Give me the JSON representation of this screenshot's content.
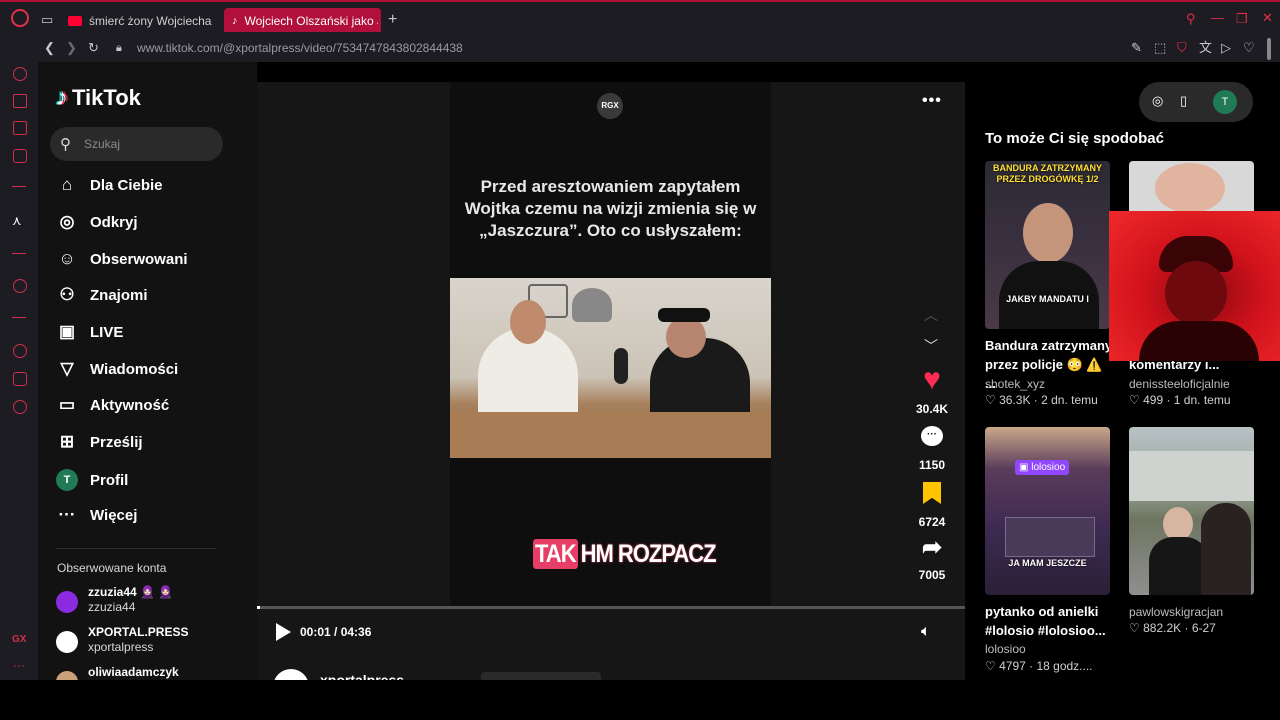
{
  "browser": {
    "tabs": [
      {
        "title": "śmierć żony Wojciecha Ol",
        "color": "#ff0033",
        "active": false
      },
      {
        "title": "Wojciech Olszański jako J",
        "color": "#25f4ee",
        "active": true
      }
    ],
    "new_tab": "+",
    "url": "www.tiktok.com/@xportalpress/video/7534747843802844438"
  },
  "tiktok": {
    "logo": "TikTok",
    "search_placeholder": "Szukaj",
    "nav": [
      {
        "label": "Dla Ciebie",
        "icon": "home-icon",
        "glyph": "⌂"
      },
      {
        "label": "Odkryj",
        "icon": "compass-icon",
        "glyph": "◎"
      },
      {
        "label": "Obserwowani",
        "icon": "following-icon",
        "glyph": "☺"
      },
      {
        "label": "Znajomi",
        "icon": "friends-icon",
        "glyph": "⚇"
      },
      {
        "label": "LIVE",
        "icon": "live-icon",
        "glyph": "▣"
      },
      {
        "label": "Wiadomości",
        "icon": "messages-icon",
        "glyph": "▽"
      },
      {
        "label": "Aktywność",
        "icon": "activity-icon",
        "glyph": "▭"
      },
      {
        "label": "Prześlij",
        "icon": "upload-icon",
        "glyph": "⊞"
      },
      {
        "label": "Profil",
        "icon": "profile-avatar",
        "glyph": "T"
      },
      {
        "label": "Więcej",
        "icon": "more-icon",
        "glyph": "···"
      }
    ],
    "followed_title": "Obserwowane konta",
    "followed": [
      {
        "name": "zzuzia44 🧕🏻 🧕🏻",
        "handle": "zzuzia44",
        "color": "#8a2be2"
      },
      {
        "name": "XPORTAL.PRESS",
        "handle": "xportalpress",
        "color": "#ffffff"
      },
      {
        "name": "oliwiaadamczyk",
        "handle": "",
        "color": "#c9a27a"
      }
    ]
  },
  "video": {
    "channel_badge": "RGX",
    "caption": "Przed aresztowaniem zapytałem Wojtka czemu na wizji zmienia się w „Jaszczura”. Oto co usłyszałem:",
    "overlay_a": "TAK",
    "overlay_b": "HM ROZPACZ",
    "time": "00:01 / 04:36",
    "progress": 0.004,
    "author": "xportalpress",
    "likes": "30.4K",
    "comments": "1150",
    "saves": "6724",
    "shares": "7005"
  },
  "right": {
    "title": "To może Ci się spodobać",
    "cards": [
      {
        "title": "Bandura zatrzymany przez policje 😳 ⚠️ ...",
        "user": "shotek_xyz",
        "likes": "36.3K",
        "age": "2 dn. temu",
        "overlay_top": "BANDURA ZATRZYMANY PRZEZ DROGÓWKĘ 1/2",
        "overlay_bottom": "JAKBY MANDATU I"
      },
      {
        "title": "komentarzy i...",
        "user": "denissteeloficjalnie",
        "likes": "499",
        "age": "1 dn. temu"
      },
      {
        "title": "pytanko od anielki #lolosio #lolosioo...",
        "user": "lolosioo",
        "likes": "4797",
        "age": "18 godz....",
        "overlay_tag": "lolosioo",
        "overlay_bottom": "JA MAM JESZCZE"
      },
      {
        "title": "",
        "user": "pawlowskigracjan",
        "likes": "882.2K",
        "age": "6-27"
      }
    ]
  },
  "opera_sidebar": {
    "label": "GX"
  }
}
